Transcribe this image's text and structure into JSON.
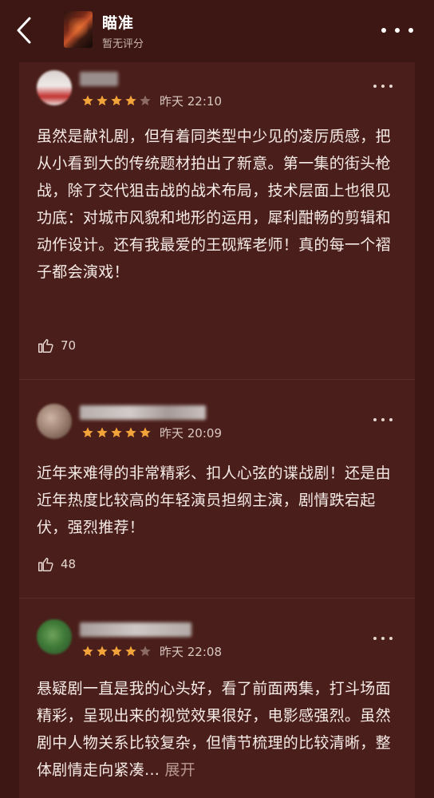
{
  "header": {
    "title": "瞄准",
    "subtitle": "暂无评分"
  },
  "colors": {
    "background": "#3d1713",
    "card": "#4a1e1a",
    "star": "#f2a33a",
    "star_empty": "#8a6a63"
  },
  "icons": [
    "back-arrow-icon",
    "more-dots-icon",
    "thumbs-up-icon",
    "star-icon"
  ],
  "reviews": [
    {
      "rating": 4,
      "time": "昨天 22:10",
      "text": "虽然是献礼剧，但有着同类型中少见的凌厉质感，把从小看到大的传统题材拍出了新意。第一集的街头枪战，除了交代狙击战的战术布局，技术层面上也很见功底：对城市风貌和地形的运用，犀利酣畅的剪辑和动作设计。还有我最爱的王砚辉老师！真的每一个褶子都会演戏！",
      "likes": "70"
    },
    {
      "rating": 5,
      "time": "昨天 20:09",
      "text": "近年来难得的非常精彩、扣人心弦的谍战剧！还是由近年热度比较高的年轻演员担纲主演，剧情跌宕起伏，强烈推荐！",
      "likes": "48"
    },
    {
      "rating": 4,
      "time": "昨天 22:08",
      "text": "悬疑剧一直是我的心头好，看了前面两集，打斗场面精彩，呈现出来的视觉效果很好，电影感强烈。虽然剧中人物关系比较复杂，但情节梳理的比较清晰，整体剧情走向紧凑...",
      "expand_label": "展开"
    }
  ]
}
